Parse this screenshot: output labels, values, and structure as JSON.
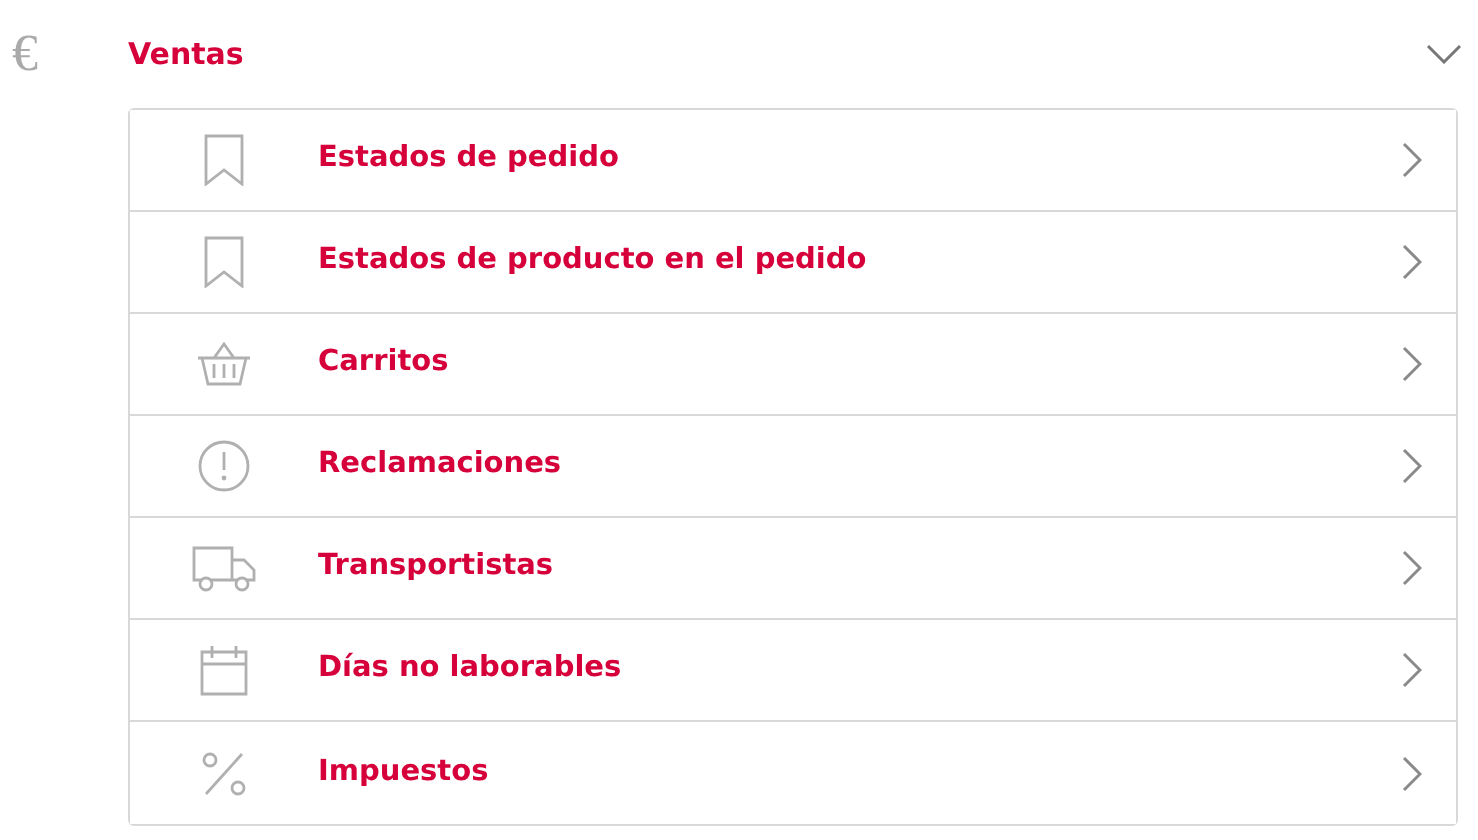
{
  "section": {
    "icon": "€",
    "title": "Ventas",
    "expanded": true
  },
  "items": [
    {
      "label": "Estados de pedido",
      "kind": "bookmark"
    },
    {
      "label": "Estados de producto en el pedido",
      "kind": "bookmark"
    },
    {
      "label": "Carritos",
      "kind": "basket"
    },
    {
      "label": "Reclamaciones",
      "kind": "alert"
    },
    {
      "label": "Transportistas",
      "kind": "truck"
    },
    {
      "label": "Días no laborables",
      "kind": "calendar"
    },
    {
      "label": "Impuestos",
      "kind": "percent"
    }
  ]
}
